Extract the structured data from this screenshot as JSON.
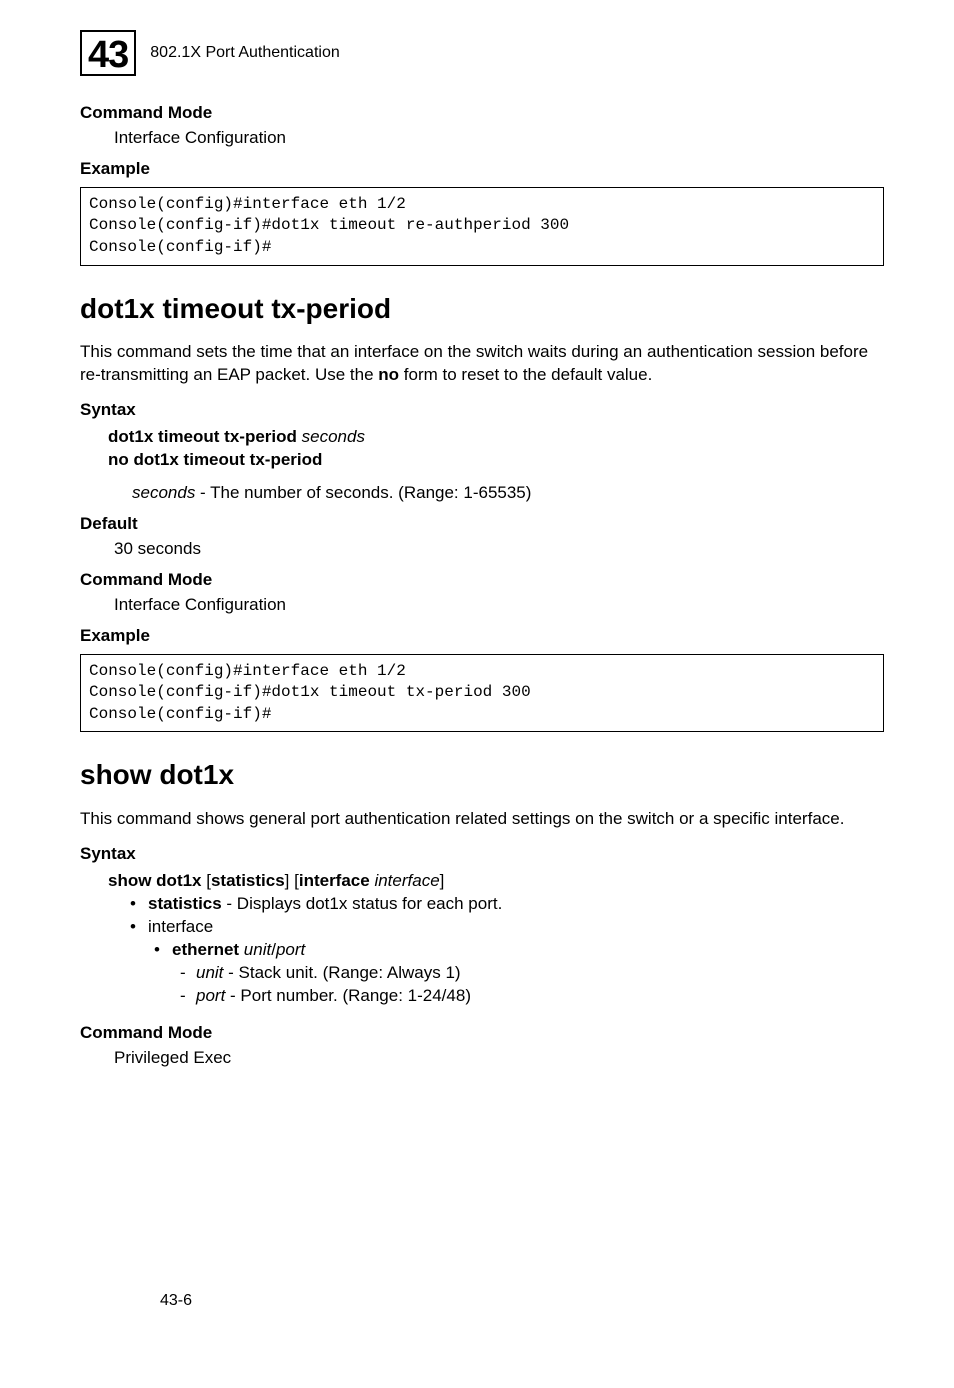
{
  "header": {
    "chapter_number": "43",
    "chapter_title": "802.1X Port Authentication"
  },
  "sec1": {
    "cmd_mode_h": "Command Mode",
    "cmd_mode_txt": "Interface Configuration",
    "example_h": "Example",
    "code": "Console(config)#interface eth 1/2\nConsole(config-if)#dot1x timeout re-authperiod 300\nConsole(config-if)#"
  },
  "sec2": {
    "title": "dot1x timeout tx-period",
    "desc_a": "This command sets the time that an interface on the switch waits during an authentication session before re-transmitting an EAP packet. Use the ",
    "desc_b": "no",
    "desc_c": " form to reset to the default value.",
    "syntax_h": "Syntax",
    "syntax_l1_b": "dot1x timeout tx-period",
    "syntax_l1_i": " seconds",
    "syntax_l2_b": "no dot1x timeout tx-period",
    "syntax_sub_i": "seconds",
    "syntax_sub_t": " - The number of seconds. (Range: 1-65535)",
    "default_h": "Default",
    "default_txt": "30 seconds",
    "cmd_mode_h": "Command Mode",
    "cmd_mode_txt": "Interface Configuration",
    "example_h": "Example",
    "code": "Console(config)#interface eth 1/2\nConsole(config-if)#dot1x timeout tx-period 300\nConsole(config-if)#"
  },
  "sec3": {
    "title": "show dot1x",
    "desc": "This command shows general port authentication related settings on the switch or a specific interface.",
    "syntax_h": "Syntax",
    "syn_b1": "show dot1x",
    "syn_t1": " [",
    "syn_b2": "statistics",
    "syn_t2": "] [",
    "syn_b3": "interface",
    "syn_t3": " ",
    "syn_i1": "interface",
    "syn_t4": "]",
    "bullet1_b": "statistics",
    "bullet1_t": " - Displays dot1x status for each port.",
    "bullet2_t": "interface",
    "sub1_b": "ethernet",
    "sub1_i": " unit",
    "sub1_t": "/",
    "sub1_i2": "port",
    "dash1_i": "unit",
    "dash1_t": " - Stack unit. (Range: Always 1)",
    "dash2_i": "port",
    "dash2_t": " - Port number. (Range: 1-24/48)",
    "cmd_mode_h": "Command Mode",
    "cmd_mode_txt": "Privileged Exec"
  },
  "footer": {
    "page": "43-6"
  }
}
